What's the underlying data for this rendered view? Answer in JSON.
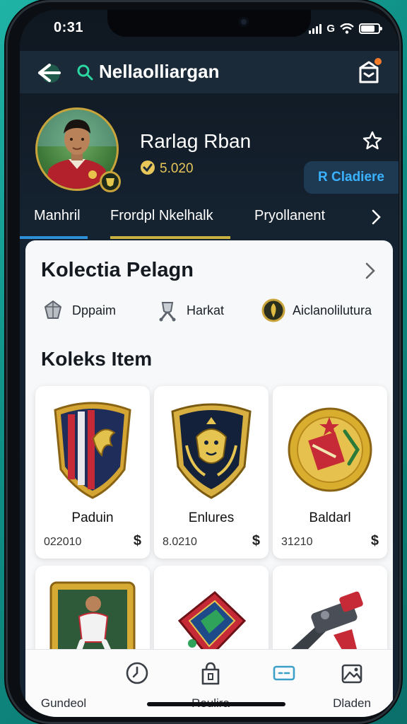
{
  "status": {
    "time": "0:31",
    "network": "G"
  },
  "header": {
    "title": "Nellaolliargan"
  },
  "profile": {
    "name": "Rarlag Rban",
    "coins": "5.020",
    "action_label": "R Cladiere"
  },
  "tabs": [
    {
      "label": "Manhril"
    },
    {
      "label": "Frordpl Nkelhalk"
    },
    {
      "label": "Pryollanent"
    }
  ],
  "collection": {
    "title": "Kolectia Pelagn",
    "categories": [
      {
        "label": "Dppaim",
        "icon": "gem-icon"
      },
      {
        "label": "Harkat",
        "icon": "trophy-icon"
      },
      {
        "label": "Aiclanolilutura",
        "icon": "emblem-icon"
      }
    ]
  },
  "items_section": {
    "title": "Koleks Item"
  },
  "items": [
    {
      "name": "Paduin",
      "price": "022010",
      "currency": "$",
      "icon": "crest-shield-icon"
    },
    {
      "name": "Enlures",
      "price": "8.0210",
      "currency": "$",
      "icon": "lion-shield-icon"
    },
    {
      "name": "Baldarl",
      "price": "31210",
      "currency": "$",
      "icon": "gold-medal-icon"
    },
    {
      "name": "",
      "price": "",
      "currency": "",
      "icon": "player-card-icon"
    },
    {
      "name": "",
      "price": "",
      "currency": "",
      "icon": "gear-pack-icon"
    },
    {
      "name": "",
      "price": "",
      "currency": "",
      "icon": "blaster-icon"
    }
  ],
  "nav": [
    {
      "label": "Gundeol",
      "icon": "home-icon"
    },
    {
      "label": "",
      "icon": "clock-icon"
    },
    {
      "label": "Reulira",
      "icon": "bag-icon"
    },
    {
      "label": "",
      "icon": "ticket-icon"
    },
    {
      "label": "Dladen",
      "icon": "gallery-icon"
    }
  ],
  "colors": {
    "accent_blue": "#3ab2ff",
    "coin_gold": "#e7c65a",
    "header_bg": "#1b2a38",
    "badge_orange": "#f47b2a"
  }
}
